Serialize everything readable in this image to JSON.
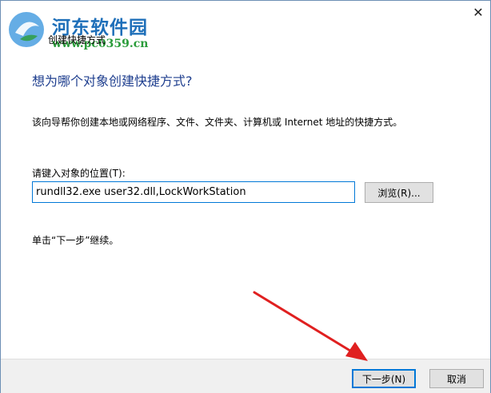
{
  "titlebar": {
    "title": "创建快捷方式",
    "close_label": "✕"
  },
  "watermark": {
    "site_name": "河东软件园",
    "url": "www.pc0359.cn"
  },
  "page": {
    "heading": "想为哪个对象创建快捷方式?",
    "description": "该向导帮你创建本地或网络程序、文件、文件夹、计算机或 Internet 地址的快捷方式。",
    "location_label": "请键入对象的位置(T):",
    "location_value": "rundll32.exe user32.dll,LockWorkStation",
    "browse_label": "浏览(R)...",
    "hint": "单击“下一步”继续。"
  },
  "footer": {
    "next_label": "下一步(N)",
    "cancel_label": "取消"
  },
  "colors": {
    "accent": "#0078d7",
    "heading": "#1f3f8f",
    "annotation_arrow": "#e02020",
    "watermark_text": "#1e6fb9",
    "watermark_url": "#2a9c3a"
  }
}
